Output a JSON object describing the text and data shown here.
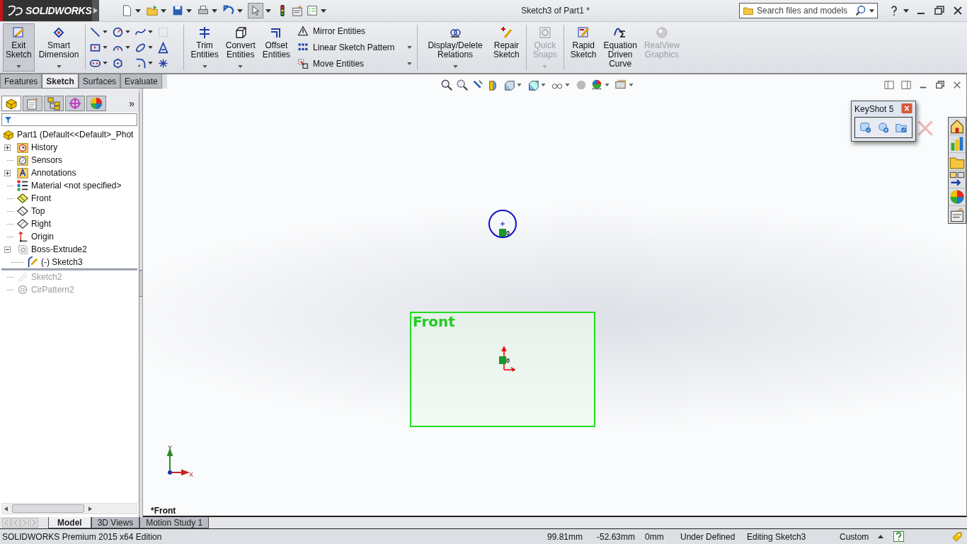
{
  "app": {
    "logo": "SOLIDWORKS",
    "title": "Sketch3 of Part1 *",
    "search": {
      "placeholder": "Search files and models"
    }
  },
  "ribbon": {
    "sketch_group": [
      {
        "label": "Exit Sketch",
        "selected": true,
        "disabled": false,
        "has_menu": true
      },
      {
        "label": "Smart Dimension",
        "selected": false,
        "disabled": false,
        "has_menu": true
      }
    ],
    "edit_group": [
      {
        "label": "Trim Entities",
        "selected": false,
        "disabled": false,
        "has_menu": true
      },
      {
        "label": "Convert Entities",
        "selected": false,
        "disabled": false,
        "has_menu": true
      },
      {
        "label": "Offset Entities",
        "selected": false,
        "disabled": false,
        "has_menu": false
      }
    ],
    "pattern_group": [
      {
        "label": "Mirror Entities",
        "has_menu": false
      },
      {
        "label": "Linear Sketch Pattern",
        "has_menu": true
      },
      {
        "label": "Move Entities",
        "has_menu": true
      }
    ],
    "relations_group": [
      {
        "label": "Display/Delete Relations",
        "selected": false,
        "disabled": false,
        "has_menu": true
      },
      {
        "label": "Repair Sketch",
        "selected": false,
        "disabled": false,
        "has_menu": false
      }
    ],
    "snaps_group": [
      {
        "label": "Quick Snaps",
        "selected": false,
        "disabled": true,
        "has_menu": true
      }
    ],
    "extra_group": [
      {
        "label": "Rapid Sketch",
        "selected": false,
        "disabled": false,
        "has_menu": false
      },
      {
        "label": "Equation Driven Curve",
        "selected": false,
        "disabled": false,
        "has_menu": false
      },
      {
        "label": "RealView Graphics",
        "selected": false,
        "disabled": true,
        "has_menu": false
      }
    ]
  },
  "command_tabs": [
    {
      "label": "Features",
      "selected": false
    },
    {
      "label": "Sketch",
      "selected": true
    },
    {
      "label": "Surfaces",
      "selected": false
    },
    {
      "label": "Evaluate",
      "selected": false
    }
  ],
  "panel": {
    "more": "»",
    "tree": {
      "label": "Part1 (Default<<Default>_Phot",
      "children": [
        {
          "label": "History",
          "expandable": true,
          "expanded": false,
          "rolled_back": false
        },
        {
          "label": "Sensors",
          "expandable": false,
          "rolled_back": false
        },
        {
          "label": "Annotations",
          "expandable": true,
          "expanded": false,
          "rolled_back": false
        },
        {
          "label": "Material <not specified>",
          "expandable": false,
          "rolled_back": false
        },
        {
          "label": "Front",
          "expandable": false,
          "rolled_back": false
        },
        {
          "label": "Top",
          "expandable": false,
          "rolled_back": false
        },
        {
          "label": "Right",
          "expandable": false,
          "rolled_back": false
        },
        {
          "label": "Origin",
          "expandable": false,
          "rolled_back": false
        },
        {
          "label": "Boss-Extrude2",
          "expandable": true,
          "expanded": true,
          "rolled_back": false,
          "children": [
            {
              "label": "(-) Sketch3"
            }
          ]
        },
        {
          "label": "Sketch2",
          "expandable": false,
          "rolled_back": true
        },
        {
          "label": "CirPattern2",
          "expandable": false,
          "rolled_back": true
        }
      ]
    }
  },
  "viewport": {
    "view_name": "*Front",
    "plane_label": "Front",
    "relation_marks": [
      "0",
      "0"
    ],
    "triad": {
      "y": "Y",
      "x": "X"
    },
    "keyshot": {
      "title": "KeyShot 5"
    }
  },
  "bottom_tabs": [
    {
      "label": "Model",
      "selected": true
    },
    {
      "label": "3D Views",
      "selected": false
    },
    {
      "label": "Motion Study 1",
      "selected": false
    }
  ],
  "status_bar": {
    "edition": "SOLIDWORKS Premium 2015 x64 Edition",
    "fields": [
      "99.81mm",
      "-52.63mm",
      "0mm",
      "Under Defined",
      "Editing Sketch3",
      "Custom"
    ]
  }
}
